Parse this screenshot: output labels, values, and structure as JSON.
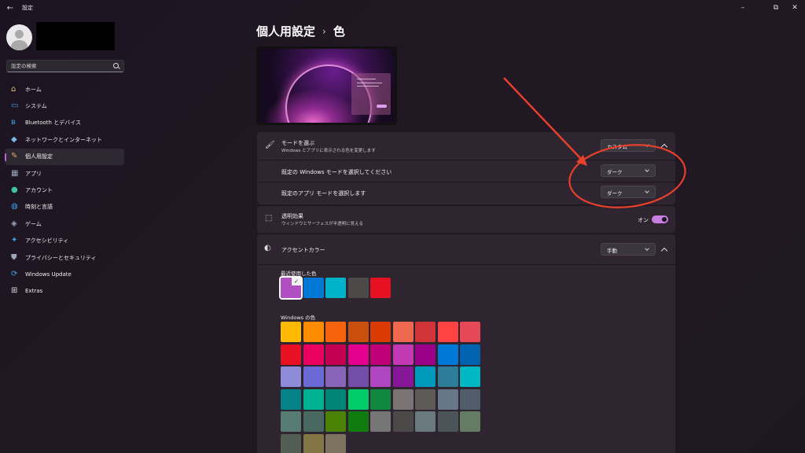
{
  "window": {
    "title": "設定",
    "back": "←",
    "minimize": "–",
    "maximize": "⧉",
    "close": "✕"
  },
  "sidebar": {
    "search_placeholder": "設定の検索",
    "items": [
      {
        "label": "ホーム",
        "icon": "home-icon",
        "color": "#f0c08a"
      },
      {
        "label": "システム",
        "icon": "system-icon",
        "color": "#3fa3e8"
      },
      {
        "label": "Bluetooth とデバイス",
        "icon": "bluetooth-icon",
        "color": "#3fa3e8"
      },
      {
        "label": "ネットワークとインターネット",
        "icon": "network-icon",
        "color": "#7fb6e8"
      },
      {
        "label": "個人用設定",
        "icon": "brush-icon",
        "color": "#e8a86a"
      },
      {
        "label": "アプリ",
        "icon": "apps-icon",
        "color": "#9aa8b8"
      },
      {
        "label": "アカウント",
        "icon": "account-icon",
        "color": "#3fc6a0"
      },
      {
        "label": "時刻と言語",
        "icon": "globe-icon",
        "color": "#3fa3e8"
      },
      {
        "label": "ゲーム",
        "icon": "game-icon",
        "color": "#9aa8b8"
      },
      {
        "label": "アクセシビリティ",
        "icon": "accessibility-icon",
        "color": "#3fa3e8"
      },
      {
        "label": "プライバシーとセキュリティ",
        "icon": "shield-icon",
        "color": "#9aa8b8"
      },
      {
        "label": "Windows Update",
        "icon": "update-icon",
        "color": "#3fa3e8"
      },
      {
        "label": "Extras",
        "icon": "extras-icon",
        "color": "#dddddd"
      }
    ],
    "active_index": 4
  },
  "header": {
    "parent": "個人用設定",
    "separator": "›",
    "current": "色"
  },
  "mode": {
    "title": "モードを選ぶ",
    "description": "Windows とアプリに表示される色を変更します",
    "value": "カスタム",
    "windows_mode_label": "既定の Windows モードを選択してください",
    "windows_mode_value": "ダーク",
    "app_mode_label": "既定のアプリ モードを選択します",
    "app_mode_value": "ダーク"
  },
  "transparency": {
    "title": "透明効果",
    "description": "ウィンドウとサーフェスが半透明に見える",
    "state": "オン"
  },
  "accent": {
    "title": "アクセントカラー",
    "value": "手動",
    "recent_label": "最近使用した色",
    "recent_colors": [
      "#b04ec2",
      "#0078d4",
      "#00b3c8",
      "#4c4a48",
      "#e81123"
    ],
    "windows_label": "Windows の色",
    "windows_colors": [
      [
        "#ffb900",
        "#ff8c00",
        "#f7630c",
        "#ca5010",
        "#da3b01",
        "#ef6950",
        "#d13438",
        "#ff4343",
        "#e74856"
      ],
      [
        "#e81123",
        "#ea005e",
        "#c30052",
        "#e3008c",
        "#bf0077",
        "#c239b3",
        "#9a0089",
        "#0078d7",
        "#0063b1"
      ],
      [
        "#8e8cd8",
        "#6b69d6",
        "#8764b8",
        "#744da9",
        "#b146c2",
        "#881798",
        "#0099bc",
        "#2d7d9a",
        "#00b7c3"
      ],
      [
        "#038387",
        "#00b294",
        "#018574",
        "#00cc6a",
        "#10893e",
        "#7a7574",
        "#5d5a58",
        "#68768a",
        "#515c6b"
      ],
      [
        "#567c73",
        "#486860",
        "#498205",
        "#107c10",
        "#767676",
        "#4c4a48",
        "#69797e",
        "#4a5459",
        "#647c64"
      ],
      [
        "#525e54",
        "#847545",
        "#7e735f"
      ]
    ]
  },
  "annotation": {
    "color": "#e8402a"
  }
}
